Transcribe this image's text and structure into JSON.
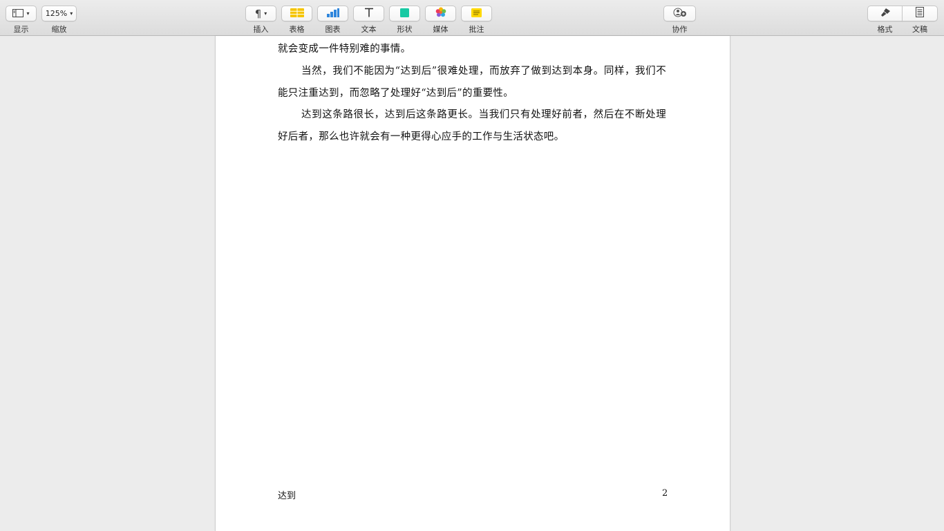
{
  "toolbar": {
    "view": {
      "label": "显示",
      "icon": "sidebar-view-icon"
    },
    "zoom": {
      "label": "缩放",
      "value": "125%"
    },
    "insert": {
      "label": "插入",
      "icon": "pilcrow-icon"
    },
    "table": {
      "label": "表格",
      "icon": "table-icon"
    },
    "chart": {
      "label": "图表",
      "icon": "chart-icon"
    },
    "text": {
      "label": "文本",
      "icon": "text-icon"
    },
    "shape": {
      "label": "形状",
      "icon": "shape-icon"
    },
    "media": {
      "label": "媒体",
      "icon": "media-icon"
    },
    "comment": {
      "label": "批注",
      "icon": "comment-icon"
    },
    "collaborate": {
      "label": "协作",
      "icon": "collaborate-icon"
    },
    "format": {
      "label": "格式",
      "icon": "format-brush-icon"
    },
    "document": {
      "label": "文稿",
      "icon": "document-icon"
    }
  },
  "colors": {
    "table_yellow": "#f5c400",
    "chart_blue": "#2f86dc",
    "shape_green": "#18c9a3",
    "comment_yellow": "#ffd800"
  },
  "document": {
    "paragraphs": [
      "就会变成一件特别难的事情。",
      "当然，我们不能因为“达到后”很难处理，而放弃了做到达到本身。同样，我们不能只注重达到，而忽略了处理好“达到后”的重要性。",
      "达到这条路很长，达到后这条路更长。当我们只有处理好前者，然后在不断处理好后者，那么也许就会有一种更得心应手的工作与生活状态吧。"
    ],
    "footer_title": "达到",
    "page_number": "2"
  }
}
